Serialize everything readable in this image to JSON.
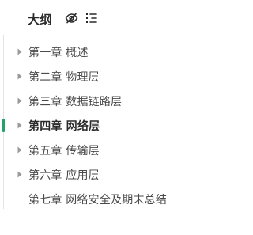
{
  "outline": {
    "title": "大纲",
    "accent_color": "#23a365",
    "icons": {
      "visibility": "eye-off-icon",
      "outline_toggle": "outline-list-icon"
    },
    "items": [
      {
        "label": "第一章 概述",
        "has_children": true,
        "active": false
      },
      {
        "label": "第二章 物理层",
        "has_children": true,
        "active": false
      },
      {
        "label": "第三章 数据链路层",
        "has_children": true,
        "active": false
      },
      {
        "label": "第四章 网络层",
        "has_children": true,
        "active": true
      },
      {
        "label": "第五章 传输层",
        "has_children": true,
        "active": false
      },
      {
        "label": "第六章 应用层",
        "has_children": true,
        "active": false
      },
      {
        "label": "第七章 网络安全及期末总结",
        "has_children": false,
        "active": false
      }
    ]
  }
}
